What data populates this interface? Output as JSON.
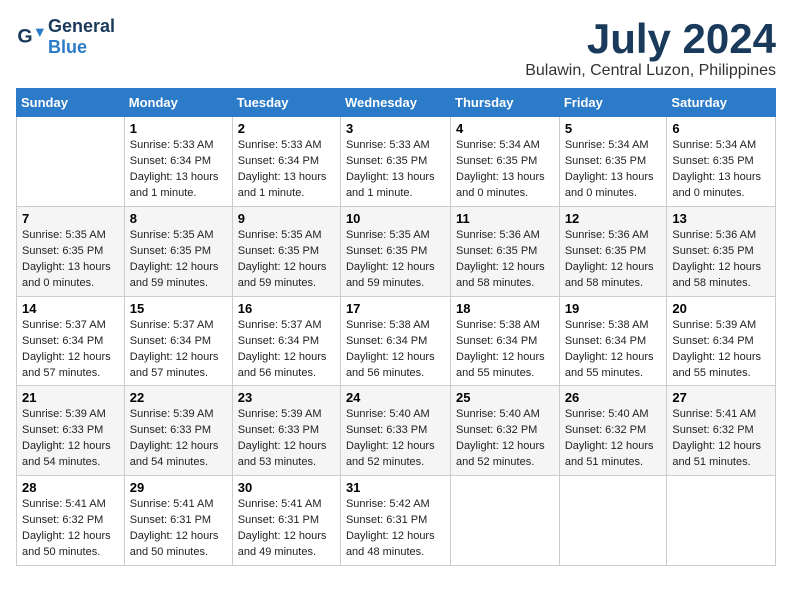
{
  "logo": {
    "line1": "General",
    "line2": "Blue"
  },
  "title": "July 2024",
  "subtitle": "Bulawin, Central Luzon, Philippines",
  "days_header": [
    "Sunday",
    "Monday",
    "Tuesday",
    "Wednesday",
    "Thursday",
    "Friday",
    "Saturday"
  ],
  "weeks": [
    [
      {
        "day": "",
        "info": ""
      },
      {
        "day": "1",
        "info": "Sunrise: 5:33 AM\nSunset: 6:34 PM\nDaylight: 13 hours and 1 minute."
      },
      {
        "day": "2",
        "info": "Sunrise: 5:33 AM\nSunset: 6:34 PM\nDaylight: 13 hours and 1 minute."
      },
      {
        "day": "3",
        "info": "Sunrise: 5:33 AM\nSunset: 6:35 PM\nDaylight: 13 hours and 1 minute."
      },
      {
        "day": "4",
        "info": "Sunrise: 5:34 AM\nSunset: 6:35 PM\nDaylight: 13 hours and 0 minutes."
      },
      {
        "day": "5",
        "info": "Sunrise: 5:34 AM\nSunset: 6:35 PM\nDaylight: 13 hours and 0 minutes."
      },
      {
        "day": "6",
        "info": "Sunrise: 5:34 AM\nSunset: 6:35 PM\nDaylight: 13 hours and 0 minutes."
      }
    ],
    [
      {
        "day": "7",
        "info": "Sunrise: 5:35 AM\nSunset: 6:35 PM\nDaylight: 13 hours and 0 minutes."
      },
      {
        "day": "8",
        "info": "Sunrise: 5:35 AM\nSunset: 6:35 PM\nDaylight: 12 hours and 59 minutes."
      },
      {
        "day": "9",
        "info": "Sunrise: 5:35 AM\nSunset: 6:35 PM\nDaylight: 12 hours and 59 minutes."
      },
      {
        "day": "10",
        "info": "Sunrise: 5:35 AM\nSunset: 6:35 PM\nDaylight: 12 hours and 59 minutes."
      },
      {
        "day": "11",
        "info": "Sunrise: 5:36 AM\nSunset: 6:35 PM\nDaylight: 12 hours and 58 minutes."
      },
      {
        "day": "12",
        "info": "Sunrise: 5:36 AM\nSunset: 6:35 PM\nDaylight: 12 hours and 58 minutes."
      },
      {
        "day": "13",
        "info": "Sunrise: 5:36 AM\nSunset: 6:35 PM\nDaylight: 12 hours and 58 minutes."
      }
    ],
    [
      {
        "day": "14",
        "info": "Sunrise: 5:37 AM\nSunset: 6:34 PM\nDaylight: 12 hours and 57 minutes."
      },
      {
        "day": "15",
        "info": "Sunrise: 5:37 AM\nSunset: 6:34 PM\nDaylight: 12 hours and 57 minutes."
      },
      {
        "day": "16",
        "info": "Sunrise: 5:37 AM\nSunset: 6:34 PM\nDaylight: 12 hours and 56 minutes."
      },
      {
        "day": "17",
        "info": "Sunrise: 5:38 AM\nSunset: 6:34 PM\nDaylight: 12 hours and 56 minutes."
      },
      {
        "day": "18",
        "info": "Sunrise: 5:38 AM\nSunset: 6:34 PM\nDaylight: 12 hours and 55 minutes."
      },
      {
        "day": "19",
        "info": "Sunrise: 5:38 AM\nSunset: 6:34 PM\nDaylight: 12 hours and 55 minutes."
      },
      {
        "day": "20",
        "info": "Sunrise: 5:39 AM\nSunset: 6:34 PM\nDaylight: 12 hours and 55 minutes."
      }
    ],
    [
      {
        "day": "21",
        "info": "Sunrise: 5:39 AM\nSunset: 6:33 PM\nDaylight: 12 hours and 54 minutes."
      },
      {
        "day": "22",
        "info": "Sunrise: 5:39 AM\nSunset: 6:33 PM\nDaylight: 12 hours and 54 minutes."
      },
      {
        "day": "23",
        "info": "Sunrise: 5:39 AM\nSunset: 6:33 PM\nDaylight: 12 hours and 53 minutes."
      },
      {
        "day": "24",
        "info": "Sunrise: 5:40 AM\nSunset: 6:33 PM\nDaylight: 12 hours and 52 minutes."
      },
      {
        "day": "25",
        "info": "Sunrise: 5:40 AM\nSunset: 6:32 PM\nDaylight: 12 hours and 52 minutes."
      },
      {
        "day": "26",
        "info": "Sunrise: 5:40 AM\nSunset: 6:32 PM\nDaylight: 12 hours and 51 minutes."
      },
      {
        "day": "27",
        "info": "Sunrise: 5:41 AM\nSunset: 6:32 PM\nDaylight: 12 hours and 51 minutes."
      }
    ],
    [
      {
        "day": "28",
        "info": "Sunrise: 5:41 AM\nSunset: 6:32 PM\nDaylight: 12 hours and 50 minutes."
      },
      {
        "day": "29",
        "info": "Sunrise: 5:41 AM\nSunset: 6:31 PM\nDaylight: 12 hours and 50 minutes."
      },
      {
        "day": "30",
        "info": "Sunrise: 5:41 AM\nSunset: 6:31 PM\nDaylight: 12 hours and 49 minutes."
      },
      {
        "day": "31",
        "info": "Sunrise: 5:42 AM\nSunset: 6:31 PM\nDaylight: 12 hours and 48 minutes."
      },
      {
        "day": "",
        "info": ""
      },
      {
        "day": "",
        "info": ""
      },
      {
        "day": "",
        "info": ""
      }
    ]
  ]
}
